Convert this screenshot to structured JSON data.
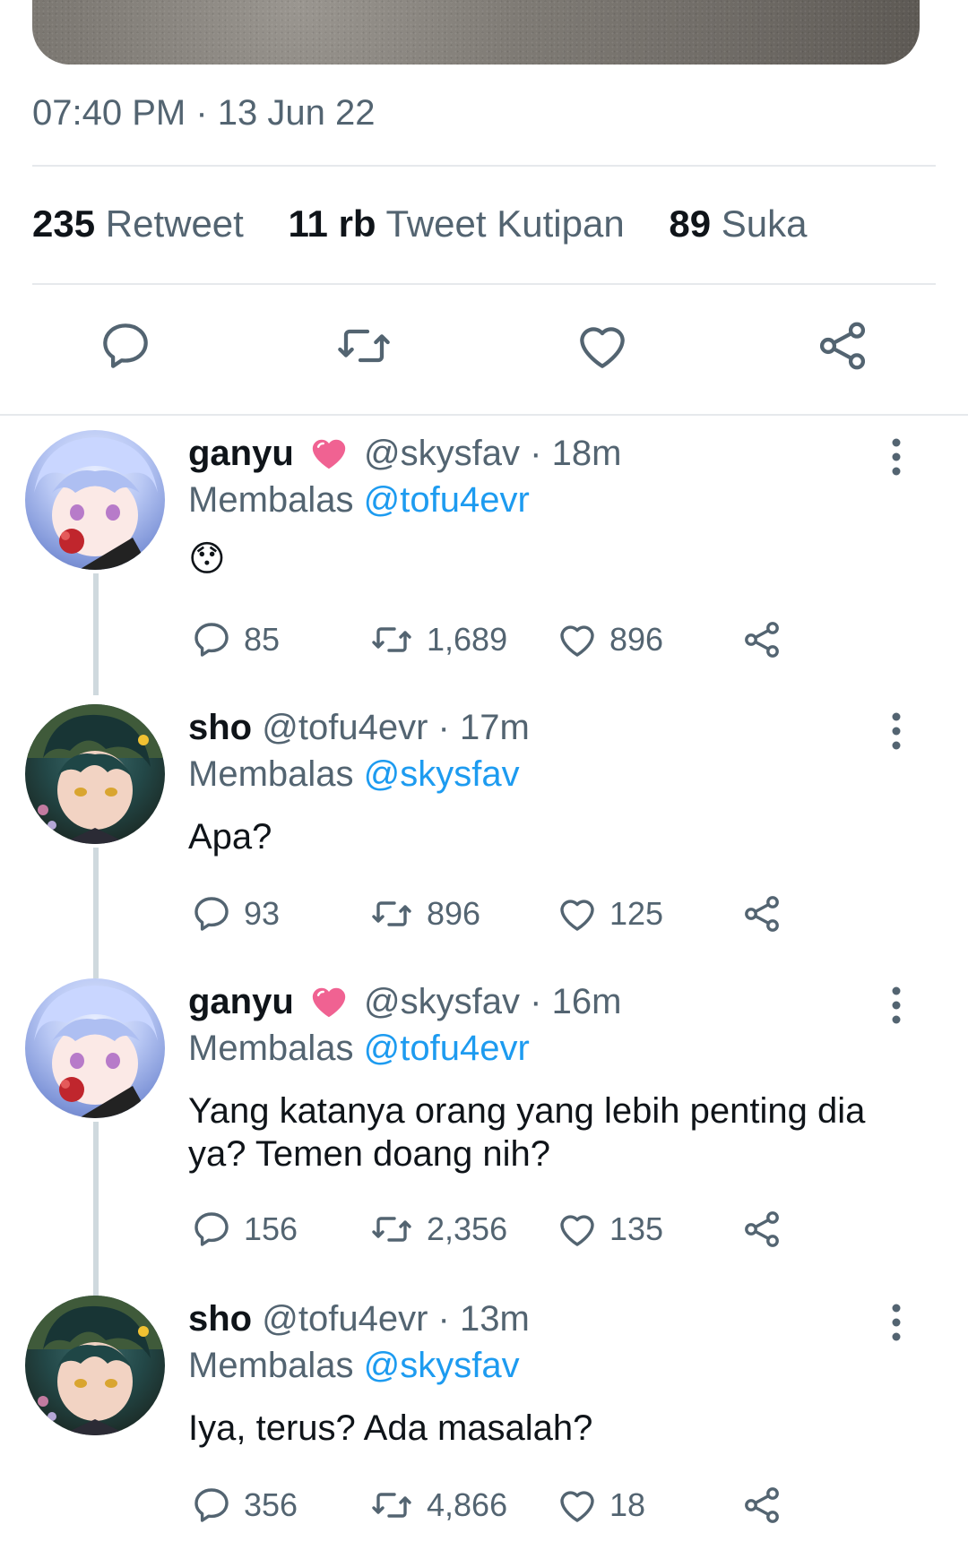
{
  "tweet": {
    "timestamp": "07:40 PM · 13 Jun 22",
    "stats": [
      {
        "value": "235",
        "label": "Retweet"
      },
      {
        "value": "11 rb",
        "label": "Tweet Kutipan"
      },
      {
        "value": "89",
        "label": "Suka"
      }
    ],
    "actions": [
      "reply-icon",
      "retweet-icon",
      "like-icon",
      "share-icon"
    ]
  },
  "replies": [
    {
      "name": "ganyu",
      "has_heart": true,
      "handle": "@skysfav",
      "time": "· 18m",
      "replying_prefix": "Membalas",
      "replying_to": "@tofu4evr",
      "text": "😯",
      "counts": {
        "reply": "85",
        "retweet": "1,689",
        "like": "896"
      }
    },
    {
      "name": "sho",
      "has_heart": false,
      "handle": "@tofu4evr",
      "time": "· 17m",
      "replying_prefix": "Membalas",
      "replying_to": "@skysfav",
      "text": "Apa?",
      "counts": {
        "reply": "93",
        "retweet": "896",
        "like": "125"
      }
    },
    {
      "name": "ganyu",
      "has_heart": true,
      "handle": "@skysfav",
      "time": "· 16m",
      "replying_prefix": "Membalas",
      "replying_to": "@tofu4evr",
      "text": "Yang katanya orang yang lebih penting dia ya? Temen doang nih?",
      "counts": {
        "reply": "156",
        "retweet": "2,356",
        "like": "135"
      }
    },
    {
      "name": "sho",
      "has_heart": false,
      "handle": "@tofu4evr",
      "time": "· 13m",
      "replying_prefix": "Membalas",
      "replying_to": "@skysfav",
      "text": "Iya, terus? Ada masalah?",
      "counts": {
        "reply": "356",
        "retweet": "4,866",
        "like": "18"
      }
    }
  ],
  "colors": {
    "text": "#0f1419",
    "secondary": "#536471",
    "mention": "#1d9bf0",
    "divider": "#e6e9ec",
    "heart_emoji": "#f06292"
  }
}
